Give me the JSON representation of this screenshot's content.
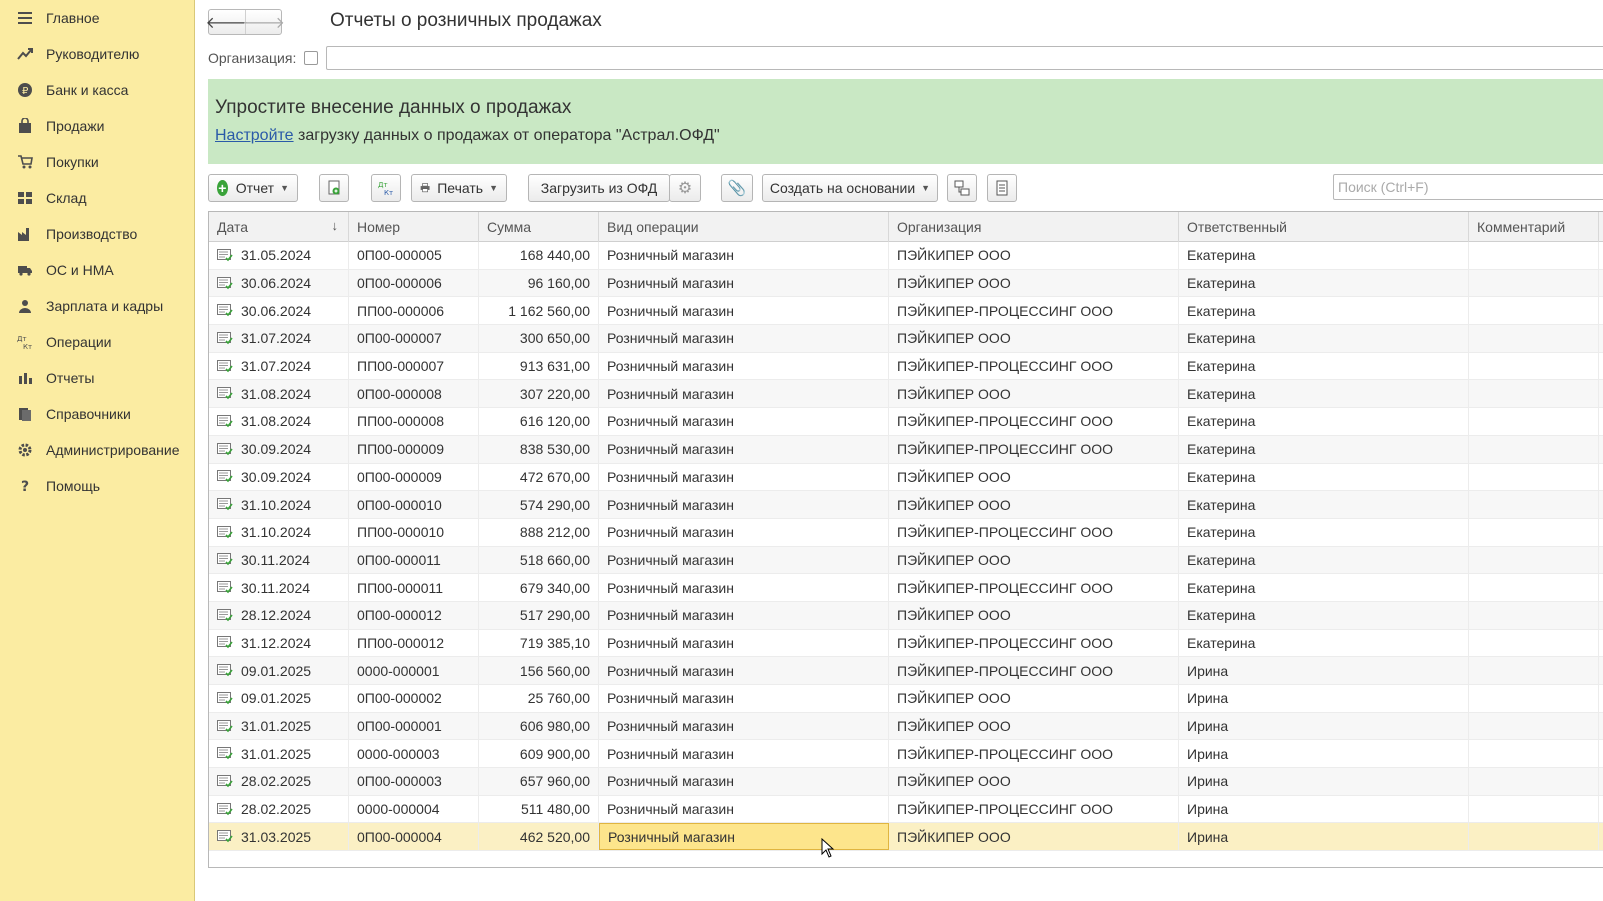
{
  "sidebar": {
    "items": [
      {
        "label": "Главное",
        "icon": "menu-icon"
      },
      {
        "label": "Руководителю",
        "icon": "trend-icon"
      },
      {
        "label": "Банк и касса",
        "icon": "coin-icon"
      },
      {
        "label": "Продажи",
        "icon": "bag-icon"
      },
      {
        "label": "Покупки",
        "icon": "cart-icon"
      },
      {
        "label": "Склад",
        "icon": "warehouse-icon"
      },
      {
        "label": "Производство",
        "icon": "factory-icon"
      },
      {
        "label": "ОС и НМА",
        "icon": "truck-icon"
      },
      {
        "label": "Зарплата и кадры",
        "icon": "person-icon"
      },
      {
        "label": "Операции",
        "icon": "dt-kt-icon"
      },
      {
        "label": "Отчеты",
        "icon": "bar-chart-icon"
      },
      {
        "label": "Справочники",
        "icon": "books-icon"
      },
      {
        "label": "Администрирование",
        "icon": "gear-icon"
      },
      {
        "label": "Помощь",
        "icon": "help-icon"
      }
    ]
  },
  "header": {
    "title": "Отчеты о розничных продажах",
    "back": "🡐",
    "forward": "🡒"
  },
  "filter": {
    "org_label": "Организация:"
  },
  "banner": {
    "title": "Упростите внесение данных о продажах",
    "link": "Настройте",
    "text": " загрузку данных о продажах от оператора \"Астрал.ОФД\""
  },
  "toolbar": {
    "report": "Отчет",
    "print": "Печать",
    "load_ofd": "Загрузить из ОФД",
    "create_based": "Создать на основании",
    "search_placeholder": "Поиск (Ctrl+F)"
  },
  "table": {
    "columns": [
      "Дата",
      "Номер",
      "Сумма",
      "Вид операции",
      "Организация",
      "Ответственный",
      "Комментарий"
    ],
    "rows": [
      [
        "31.05.2024",
        "0П00-000005",
        "168 440,00",
        "Розничный магазин",
        "ПЭЙКИПЕР ООО",
        "Екатерина"
      ],
      [
        "30.06.2024",
        "0П00-000006",
        "96 160,00",
        "Розничный магазин",
        "ПЭЙКИПЕР ООО",
        "Екатерина"
      ],
      [
        "30.06.2024",
        "ПП00-000006",
        "1 162 560,00",
        "Розничный магазин",
        "ПЭЙКИПЕР-ПРОЦЕССИНГ ООО",
        "Екатерина"
      ],
      [
        "31.07.2024",
        "0П00-000007",
        "300 650,00",
        "Розничный магазин",
        "ПЭЙКИПЕР ООО",
        "Екатерина"
      ],
      [
        "31.07.2024",
        "ПП00-000007",
        "913 631,00",
        "Розничный магазин",
        "ПЭЙКИПЕР-ПРОЦЕССИНГ ООО",
        "Екатерина"
      ],
      [
        "31.08.2024",
        "0П00-000008",
        "307 220,00",
        "Розничный магазин",
        "ПЭЙКИПЕР ООО",
        "Екатерина"
      ],
      [
        "31.08.2024",
        "ПП00-000008",
        "616 120,00",
        "Розничный магазин",
        "ПЭЙКИПЕР-ПРОЦЕССИНГ ООО",
        "Екатерина"
      ],
      [
        "30.09.2024",
        "ПП00-000009",
        "838 530,00",
        "Розничный магазин",
        "ПЭЙКИПЕР-ПРОЦЕССИНГ ООО",
        "Екатерина"
      ],
      [
        "30.09.2024",
        "0П00-000009",
        "472 670,00",
        "Розничный магазин",
        "ПЭЙКИПЕР ООО",
        "Екатерина"
      ],
      [
        "31.10.2024",
        "0П00-000010",
        "574 290,00",
        "Розничный магазин",
        "ПЭЙКИПЕР ООО",
        "Екатерина"
      ],
      [
        "31.10.2024",
        "ПП00-000010",
        "888 212,00",
        "Розничный магазин",
        "ПЭЙКИПЕР-ПРОЦЕССИНГ ООО",
        "Екатерина"
      ],
      [
        "30.11.2024",
        "0П00-000011",
        "518 660,00",
        "Розничный магазин",
        "ПЭЙКИПЕР ООО",
        "Екатерина"
      ],
      [
        "30.11.2024",
        "ПП00-000011",
        "679 340,00",
        "Розничный магазин",
        "ПЭЙКИПЕР-ПРОЦЕССИНГ ООО",
        "Екатерина"
      ],
      [
        "28.12.2024",
        "0П00-000012",
        "517 290,00",
        "Розничный магазин",
        "ПЭЙКИПЕР ООО",
        "Екатерина"
      ],
      [
        "31.12.2024",
        "ПП00-000012",
        "719 385,10",
        "Розничный магазин",
        "ПЭЙКИПЕР-ПРОЦЕССИНГ ООО",
        "Екатерина"
      ],
      [
        "09.01.2025",
        "0000-000001",
        "156 560,00",
        "Розничный магазин",
        "ПЭЙКИПЕР-ПРОЦЕССИНГ ООО",
        "Ирина"
      ],
      [
        "09.01.2025",
        "0П00-000002",
        "25 760,00",
        "Розничный магазин",
        "ПЭЙКИПЕР ООО",
        "Ирина"
      ],
      [
        "31.01.2025",
        "0П00-000001",
        "606 980,00",
        "Розничный магазин",
        "ПЭЙКИПЕР ООО",
        "Ирина"
      ],
      [
        "31.01.2025",
        "0000-000003",
        "609 900,00",
        "Розничный магазин",
        "ПЭЙКИПЕР-ПРОЦЕССИНГ ООО",
        "Ирина"
      ],
      [
        "28.02.2025",
        "0П00-000003",
        "657 960,00",
        "Розничный магазин",
        "ПЭЙКИПЕР ООО",
        "Ирина"
      ],
      [
        "28.02.2025",
        "0000-000004",
        "511 480,00",
        "Розничный магазин",
        "ПЭЙКИПЕР-ПРОЦЕССИНГ ООО",
        "Ирина"
      ],
      [
        "31.03.2025",
        "0П00-000004",
        "462 520,00",
        "Розничный магазин",
        "ПЭЙКИПЕР ООО",
        "Ирина"
      ]
    ],
    "selected_row": 21
  }
}
